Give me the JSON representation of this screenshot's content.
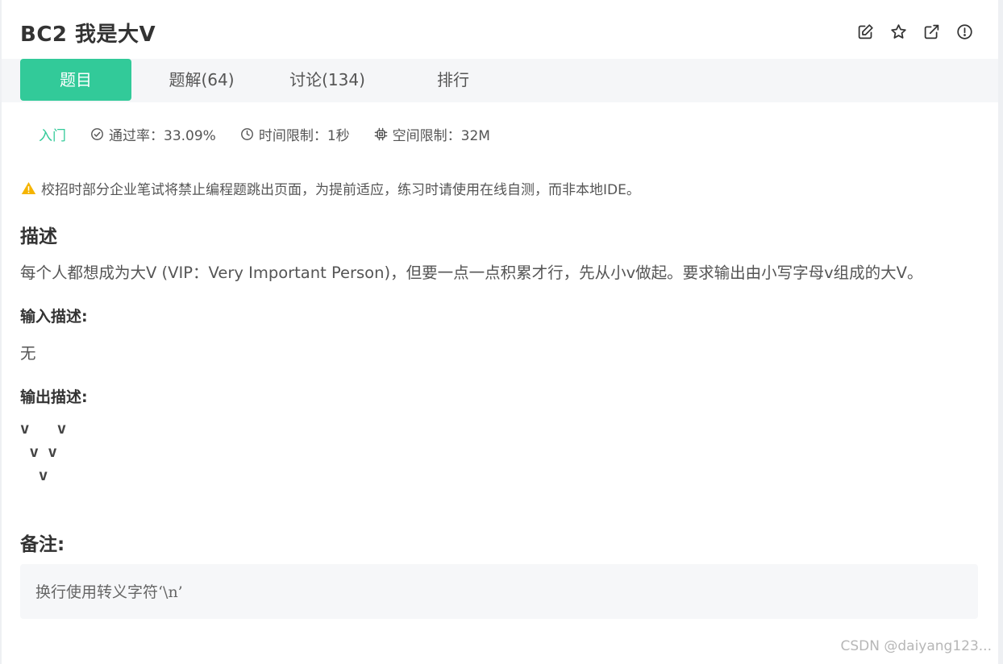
{
  "header": {
    "title": "BC2  我是大V",
    "actions": [
      {
        "icon": "edit-icon"
      },
      {
        "icon": "star-icon"
      },
      {
        "icon": "external-link-icon"
      },
      {
        "icon": "report-icon"
      }
    ]
  },
  "tabs": [
    {
      "label": "题目",
      "active": true
    },
    {
      "label": "题解(64)",
      "active": false
    },
    {
      "label": "讨论(134)",
      "active": false
    },
    {
      "label": "排行",
      "active": false
    }
  ],
  "meta": {
    "difficulty": "入门",
    "pass_rate": "通过率：33.09%",
    "time_limit": "时间限制：1秒",
    "memory_limit": "空间限制：32M"
  },
  "notice": "校招时部分企业笔试将禁止编程题跳出页面，为提前适应，练习时请使用在线自测，而非本地IDE。",
  "description": {
    "heading": "描述",
    "text": "每个人都想成为大V (VIP：Very Important Person)，但要一点一点积累才行，先从小v做起。要求输出由小写字母v组成的大V。"
  },
  "input_desc": {
    "heading": "输入描述:",
    "text": "无"
  },
  "output_desc": {
    "heading": "输出描述:",
    "lines": [
      "v   v",
      " v v",
      "  v"
    ]
  },
  "remark": {
    "heading": "备注:",
    "text": "换行使用转义字符‘\\n’"
  },
  "watermark": "CSDN @daiyang123...",
  "colors": {
    "accent": "#32ca99",
    "warning": "#f5b400",
    "tab_bar_bg": "#f5f6f8"
  }
}
